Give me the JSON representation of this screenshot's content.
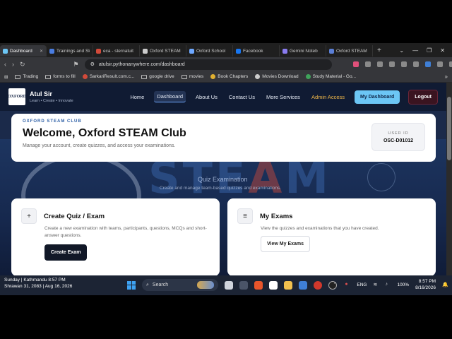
{
  "browser": {
    "tabs": [
      {
        "label": "Dashboard",
        "color": "#6cc6f5",
        "active": true
      },
      {
        "label": "Trainings and Sk",
        "color": "#4a7de0",
        "active": false
      },
      {
        "label": "eca - sternatuit",
        "color": "#d14a3a",
        "active": false
      },
      {
        "label": "Oxford STEAM",
        "color": "#cccccc",
        "active": false
      },
      {
        "label": "Oxford School",
        "color": "#6ea8ff",
        "active": false
      },
      {
        "label": "Facebook",
        "color": "#1877f2",
        "active": false
      },
      {
        "label": "Gemini Noteb",
        "color": "#8a7cf0",
        "active": false
      },
      {
        "label": "Oxford STEAM",
        "color": "#5b7fd6",
        "active": false
      }
    ],
    "url": "atulsir.pythonanywhere.com/dashboard",
    "bookmarks": [
      {
        "label": "Trading",
        "type": "folder"
      },
      {
        "label": "forms to fill",
        "type": "folder"
      },
      {
        "label": "SarkariResult.com.c...",
        "type": "site",
        "color": "#d14a3a"
      },
      {
        "label": "google drive",
        "type": "folder"
      },
      {
        "label": "movies",
        "type": "folder"
      },
      {
        "label": "Book Chapters",
        "type": "site",
        "color": "#e0b030"
      },
      {
        "label": "Movies Download",
        "type": "site",
        "color": "#cccccc"
      },
      {
        "label": "Study Material - Go...",
        "type": "site",
        "color": "#3fa25a"
      }
    ]
  },
  "site": {
    "brand_name": "Atul Sir",
    "brand_tag": "Learn • Create • Innovate",
    "logo_text": "OXFORD",
    "nav": {
      "home": "Home",
      "dashboard": "Dashboard",
      "about": "About Us",
      "contact": "Contact Us",
      "more": "More Services",
      "admin": "Admin Access",
      "my_dashboard": "My Dashboard",
      "logout": "Logout"
    },
    "hero": {
      "steam_left": "STE",
      "steam_a": "A",
      "steam_right": "M",
      "sub1": "Quiz Examination",
      "sub2": "Create and manage team-based quizzes and examinations."
    },
    "welcome": {
      "eyebrow": "OXFORD STEAM CLUB",
      "title": "Welcome, Oxford STEAM Club",
      "subtitle": "Manage your account, create quizzes, and access your examinations.",
      "user_id_label": "USER ID",
      "user_id_value": "OSC-D01012"
    },
    "quiz_card": {
      "icon": "+",
      "title": "Create Quiz / Exam",
      "desc": "Create a new examination with teams, participants, questions, MCQs and short-answer questions.",
      "button": "Create Exam"
    },
    "exams_card": {
      "icon": "≡",
      "title": "My Exams",
      "desc": "View the quizzes and examinations that you have created.",
      "button": "View My Exams"
    }
  },
  "taskbar": {
    "location_line": "Sunday | Kathmandu 8:57 PM",
    "date_line": "Shrawan 31, 2083 | Aug 16, 2026",
    "search_placeholder": "Search",
    "lang": "ENG",
    "battery": "100%",
    "time": "8:57 PM",
    "date": "8/16/2026"
  }
}
